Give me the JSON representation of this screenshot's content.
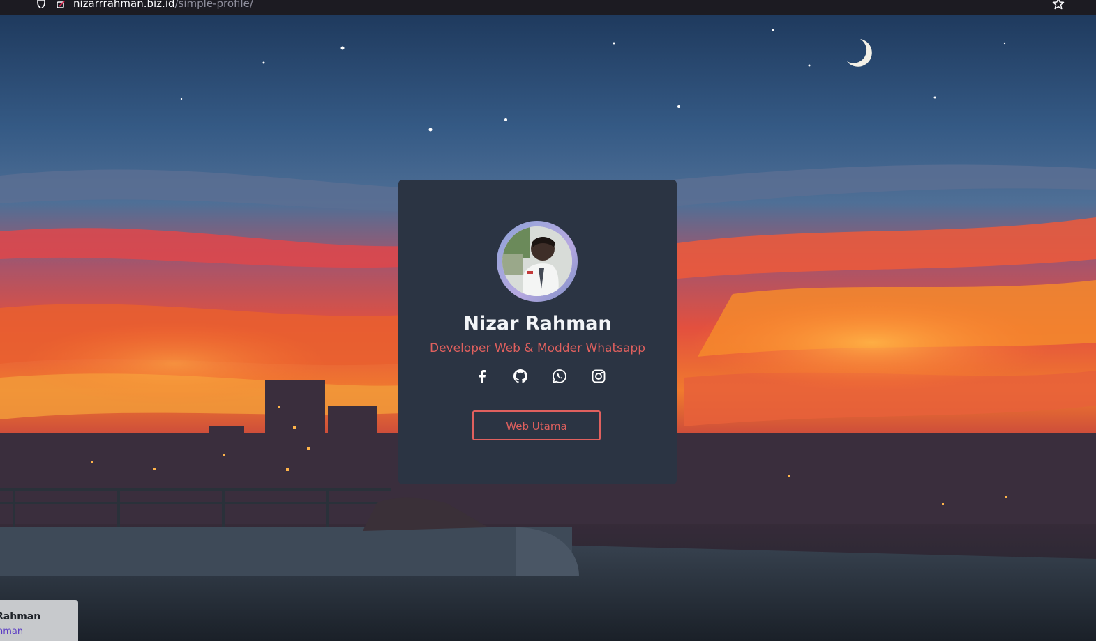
{
  "browser": {
    "url_host": "nizarrrahman.biz.id",
    "url_path": "/simple-profile/",
    "icons": [
      "shield-icon",
      "lock-icon",
      "star-icon"
    ]
  },
  "profile": {
    "name": "Nizar Rahman",
    "role": "Developer Web & Modder Whatsapp",
    "avatar": "profile-photo",
    "social_icons": [
      "facebook-icon",
      "github-icon",
      "whatsapp-icon",
      "instagram-icon"
    ],
    "button_label": "Web Utama"
  },
  "mini_card": {
    "name": "Rahman",
    "link": "ahman"
  },
  "colors": {
    "card_bg": "#2b3443",
    "accent": "#e0605e",
    "name_text": "#f2f4f7",
    "icon": "#ffffff"
  }
}
